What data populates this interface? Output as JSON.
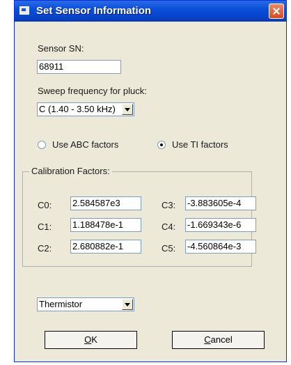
{
  "window": {
    "title": "Set Sensor Information"
  },
  "sensor_sn": {
    "label": "Sensor SN:",
    "value": "68911"
  },
  "sweep": {
    "label": "Sweep frequency for pluck:",
    "value": "C (1.40 - 3.50 kHz)"
  },
  "factor_mode": {
    "abc_label": "Use ABC factors",
    "ti_label": "Use TI factors",
    "selected": "ti"
  },
  "calibration": {
    "title": "Calibration Factors:",
    "fields": [
      {
        "label": "C0:",
        "value": "2.584587e3"
      },
      {
        "label": "C1:",
        "value": "1.188478e-1"
      },
      {
        "label": "C2:",
        "value": "2.680882e-1"
      },
      {
        "label": "C3:",
        "value": "-3.883605e-4"
      },
      {
        "label": "C4:",
        "value": "-1.669343e-6"
      },
      {
        "label": "C5:",
        "value": "-4.560864e-3"
      }
    ]
  },
  "sensor_type": {
    "value": "Thermistor"
  },
  "buttons": {
    "ok_mnemonic": "O",
    "ok_rest": "K",
    "cancel_mnemonic": "C",
    "cancel_rest": "ancel"
  }
}
